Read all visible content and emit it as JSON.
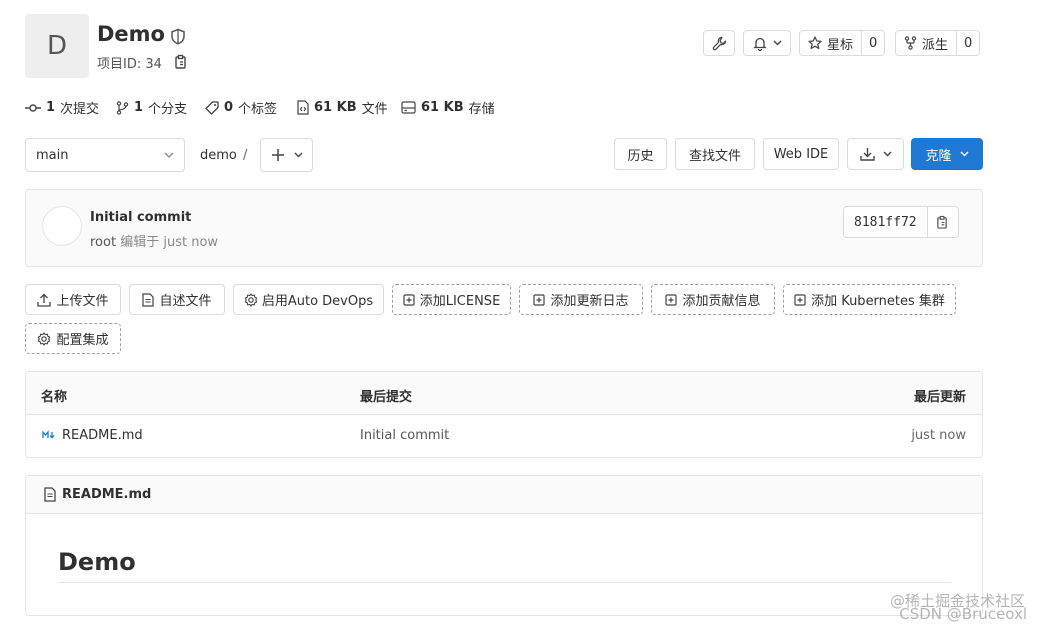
{
  "project": {
    "avatar_letter": "D",
    "title": "Demo",
    "id_label": "项目ID: 34"
  },
  "header_actions": {
    "star_label": "星标",
    "star_count": "0",
    "fork_label": "派生",
    "fork_count": "0"
  },
  "stats": {
    "commits": {
      "value": "1",
      "label": "次提交"
    },
    "branches": {
      "value": "1",
      "label": "个分支"
    },
    "tags": {
      "value": "0",
      "label": "个标签"
    },
    "files": {
      "value": "61 KB",
      "label": "文件"
    },
    "storage": {
      "value": "61 KB",
      "label": "存储"
    }
  },
  "toolbar": {
    "branch": "main",
    "path_root": "demo",
    "path_sep": "/",
    "history": "历史",
    "find_file": "查找文件",
    "web_ide": "Web IDE",
    "clone": "克隆"
  },
  "commit": {
    "title": "Initial commit",
    "author": "root",
    "action": "编辑于",
    "time": "just now",
    "sha": "8181ff72"
  },
  "quick_actions": [
    {
      "label": "上传文件",
      "icon": "upload-icon"
    },
    {
      "label": "自述文件",
      "icon": "doc-icon"
    },
    {
      "label": "启用Auto DevOps",
      "icon": "gear-icon"
    },
    {
      "label": "添加LICENSE",
      "icon": "plus-square-icon"
    },
    {
      "label": "添加更新日志",
      "icon": "plus-square-icon"
    },
    {
      "label": "添加贡献信息",
      "icon": "plus-square-icon"
    },
    {
      "label": "添加 Kubernetes 集群",
      "icon": "plus-square-icon"
    },
    {
      "label": "配置集成",
      "icon": "gear-icon"
    }
  ],
  "file_table": {
    "headers": {
      "name": "名称",
      "last_commit": "最后提交",
      "last_update": "最后更新"
    },
    "rows": [
      {
        "name": "README.md",
        "commit": "Initial commit",
        "updated": "just now"
      }
    ]
  },
  "readme": {
    "filename": "README.md",
    "heading": "Demo"
  },
  "watermark": {
    "line1": "@稀土掘金技术社区",
    "line2": "CSDN @Bruceoxl"
  }
}
